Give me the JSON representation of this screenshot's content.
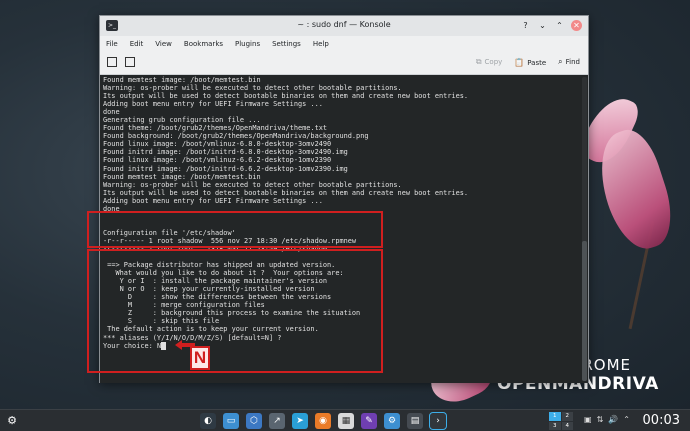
{
  "window": {
    "title": "~ : sudo dnf — Konsole",
    "app_icon": ">_"
  },
  "menubar": [
    "File",
    "Edit",
    "View",
    "Bookmarks",
    "Plugins",
    "Settings",
    "Help"
  ],
  "toolbar": {
    "copy_label": "Copy",
    "paste_label": "Paste",
    "find_label": "Find"
  },
  "terminal": {
    "lines": [
      "Found memtest image: /boot/memtest.bin",
      "Warning: os-prober will be executed to detect other bootable partitions.",
      "Its output will be used to detect bootable binaries on them and create new boot entries.",
      "Adding boot menu entry for UEFI Firmware Settings ...",
      "done",
      "Generating grub configuration file ...",
      "Found theme: /boot/grub2/themes/OpenMandriva/theme.txt",
      "Found background: /boot/grub2/themes/OpenMandriva/background.png",
      "Found linux image: /boot/vmlinuz-6.8.0-desktop-3omv2490",
      "Found initrd image: /boot/initrd-6.8.0-desktop-3omv2490.img",
      "Found linux image: /boot/vmlinuz-6.6.2-desktop-1omv2390",
      "Found initrd image: /boot/initrd-6.6.2-desktop-1omv2390.img",
      "Found memtest image: /boot/memtest.bin",
      "Warning: os-prober will be executed to detect other bootable partitions.",
      "Its output will be used to detect bootable binaries on them and create new boot entries.",
      "Adding boot menu entry for UEFI Firmware Settings ...",
      "done",
      "",
      "",
      "Configuration file '/etc/shadow'",
      "-r--r----- 1 root shadow  556 nov 27 18:30 /etc/shadow.rpmnew",
      "-r--r----- 1 root root   1378 mar 11 23:59 /etc/shadow",
      "",
      " ==> Package distributor has shipped an updated version.",
      "   What would you like to do about it ?  Your options are:",
      "    Y or I  : install the package maintainer's version",
      "    N or O  : keep your currently-installed version",
      "      D     : show the differences between the versions",
      "      M     : merge configuration files",
      "      Z     : background this process to examine the situation",
      "      S     : skip this file",
      " The default action is to keep your current version.",
      "*** aliases (Y/I/N/O/D/M/Z/S) [default=N] ?"
    ],
    "prompt": "Your choice: ",
    "typed": "N"
  },
  "annotation": {
    "label": "N",
    "color": "#d01f1f"
  },
  "branding": {
    "city": "ROME",
    "name": "OPENMANDRIVA"
  },
  "taskbar": {
    "launcher_icon": "openmandriva-launcher-icon",
    "pager": [
      "1",
      "2",
      "3",
      "4"
    ],
    "clock": "00:03"
  },
  "colors": {
    "terminal_bg": "#232627",
    "terminal_fg": "#e0e0e0",
    "accent": "#3daee9"
  }
}
